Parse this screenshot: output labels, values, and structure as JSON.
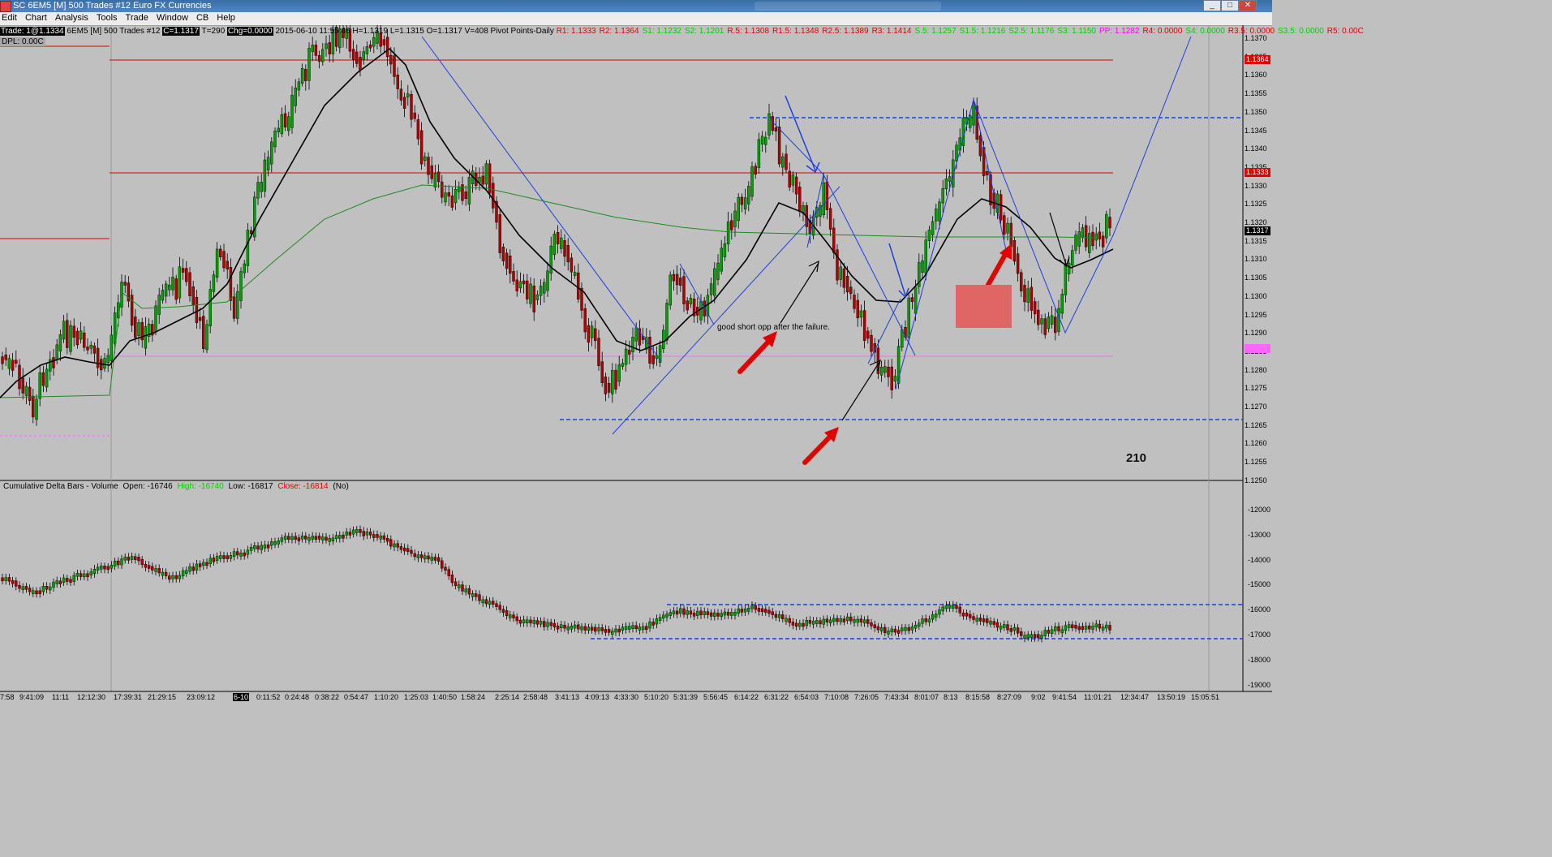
{
  "window": {
    "title": "SC 6EM5 [M]  500 Trades  #12  Euro FX Currencies",
    "buttons": {
      "minimize": "_",
      "maximize": "□",
      "close": "✕"
    }
  },
  "menu": [
    "Edit",
    "Chart",
    "Analysis",
    "Tools",
    "Trade",
    "Window",
    "CB",
    "Help"
  ],
  "info": {
    "trade": "Trade: 1@1.1334",
    "symbol": "6EM5 [M]  500 Trades  #12",
    "close": "C=1.1317",
    "ticks": "T=290",
    "chg": "Chg=0.0000",
    "stats": "2015-06-10 11:55:46 H=1.1319 L=1.1315 O=1.1317 V=408 Pivot Points-Daily",
    "dpl": "DPL: 0.00C"
  },
  "pivots": [
    {
      "t": "R1: 1.1333",
      "c": "#e00000"
    },
    {
      "t": "R2: 1.1364",
      "c": "#e00000"
    },
    {
      "t": "S1: 1.1232",
      "c": "#00d000"
    },
    {
      "t": "S2: 1.1201",
      "c": "#00d000"
    },
    {
      "t": "R.5: 1.1308",
      "c": "#e00000"
    },
    {
      "t": "R1.5: 1.1348",
      "c": "#e00000"
    },
    {
      "t": "R2.5: 1.1389",
      "c": "#e00000"
    },
    {
      "t": "R3: 1.1414",
      "c": "#e00000"
    },
    {
      "t": "S.5: 1.1257",
      "c": "#00d000"
    },
    {
      "t": "S1.5: 1.1216",
      "c": "#00d000"
    },
    {
      "t": "S2.5: 1.1176",
      "c": "#00d000"
    },
    {
      "t": "S3: 1.1150",
      "c": "#00d000"
    },
    {
      "t": "PP: 1.1282",
      "c": "#ff00ff"
    },
    {
      "t": "R4: 0.0000",
      "c": "#e00000"
    },
    {
      "t": "S4: 0.0000",
      "c": "#00d000"
    },
    {
      "t": "R3.5: 0.0000",
      "c": "#e00000"
    },
    {
      "t": "S3.5: 0.0000",
      "c": "#00d000"
    },
    {
      "t": "R5: 0.00C",
      "c": "#e00000"
    }
  ],
  "price_axis": [
    "1.1370",
    "1.1365",
    "1.1360",
    "1.1355",
    "1.1350",
    "1.1345",
    "1.1340",
    "1.1335",
    "1.1330",
    "1.1325",
    "1.1320",
    "1.1315",
    "1.1310",
    "1.1305",
    "1.1300",
    "1.1295",
    "1.1290",
    "1.1285",
    "1.1280",
    "1.1275",
    "1.1270",
    "1.1265",
    "1.1260",
    "1.1255",
    "1.1250"
  ],
  "price_tags": [
    {
      "t": "1.1364",
      "bg": "#e00000",
      "fg": "#ffffff"
    },
    {
      "t": "1.1333",
      "bg": "#e00000",
      "fg": "#ffffff"
    },
    {
      "t": "1.1317",
      "bg": "#000000",
      "fg": "#ffffff"
    },
    {
      "t": "1.1285",
      "bg": "#ff66ff",
      "fg": "#ff66ff"
    }
  ],
  "delta": {
    "title": "Cumulative Delta Bars - Volume",
    "open": "Open: -16746",
    "high": "High: -16740",
    "low": "Low: -16817",
    "close": "Close: -16814",
    "no": "(No)",
    "axis": [
      "-12000",
      "-13000",
      "-14000",
      "-15000",
      "-16000",
      "-17000",
      "-18000",
      "-19000"
    ]
  },
  "time_axis": [
    "7:58",
    "9:41:09",
    "11:11",
    "12:12:30",
    "17:39:31",
    "21:29:15",
    "23:09:12",
    "6-10",
    "0:11:52",
    "0:24:48",
    "0:38:22",
    "0:54:47",
    "1:10:20",
    "1:25:03",
    "1:40:50",
    "1:58:24",
    "2:25:14",
    "2:58:48",
    "3:41:13",
    "4:09:13",
    "4:33:30",
    "5:10:20",
    "5:31:39",
    "5:56:45",
    "6:14:22",
    "6:31:22",
    "6:54:03",
    "7:10:08",
    "7:26:05",
    "7:43:34",
    "8:01:07",
    "8:13",
    "8:15:58",
    "8:27:09",
    "9:02",
    "9:41:54",
    "11:01:21",
    "12:34:47",
    "13:50:19",
    "15:05:51"
  ],
  "annotations": {
    "note": "good short opp after the failure.",
    "number": "210"
  },
  "colors": {
    "background": "#c0c0c0",
    "up_candle": "#00a000",
    "down_candle": "#b00000",
    "ma_fast": "#000000",
    "ma_slow": "#1f8a1f",
    "resistance": "#e00000",
    "pivot": "#ff00ff",
    "trendline": "#1f3fd6",
    "arrow_red": "#e00000",
    "box": "#e06666"
  }
}
